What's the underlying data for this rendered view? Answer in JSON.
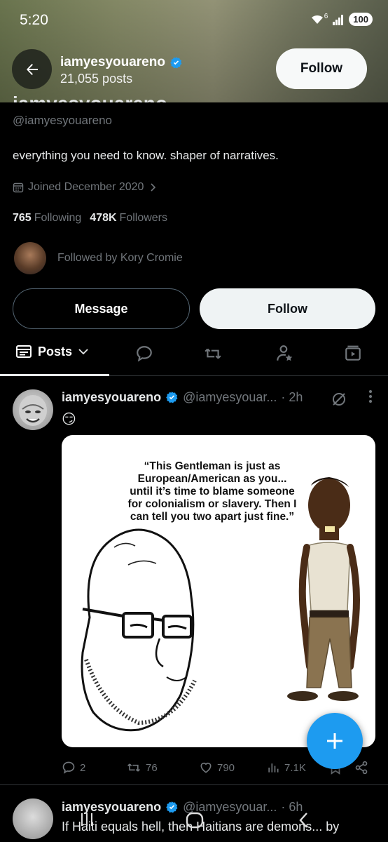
{
  "status": {
    "time": "5:20",
    "battery": "100",
    "network": "6"
  },
  "header": {
    "name": "iamyesyouareno",
    "posts_count": "21,055 posts",
    "follow_label": "Follow"
  },
  "profile": {
    "name": "iamyesyouareno",
    "handle": "@iamyesyouareno",
    "bio": "everything you need to know. shaper of narratives.",
    "joined": "Joined December 2020",
    "following_count": "765",
    "following_label": "Following",
    "followers_count": "478K",
    "followers_label": "Followers",
    "followed_by": "Followed by Kory Cromie",
    "message_label": "Message",
    "follow_label": "Follow"
  },
  "tabs": {
    "posts_label": "Posts"
  },
  "post": {
    "name": "iamyesyouareno",
    "handle": "@iamyesyouar...",
    "time": "· 2h",
    "emoji": "😏",
    "quote": "“This Gentleman is just as European/American as you... until it’s time to blame someone for colonialism or slavery. Then I can tell you two apart just fine.”",
    "replies": "2",
    "reposts": "76",
    "likes": "790",
    "views": "7.1K"
  },
  "next_post": {
    "name": "iamyesyouareno",
    "handle": "@iamyesyouar...",
    "time": "· 6h",
    "text": "If Haiti equals hell, then Haitians are demons... by"
  },
  "colors": {
    "accent": "#1d9bf0",
    "background": "#000000",
    "muted": "#71767b"
  },
  "icons": [
    "back-arrow-icon",
    "verified-badge-icon",
    "calendar-icon",
    "chevron-right-icon",
    "posts-icon",
    "chevron-down-icon",
    "reply-icon",
    "repost-icon",
    "community-icon",
    "video-icon",
    "grok-icon",
    "more-icon",
    "like-icon",
    "views-icon",
    "bookmark-icon",
    "share-icon",
    "plus-icon"
  ]
}
